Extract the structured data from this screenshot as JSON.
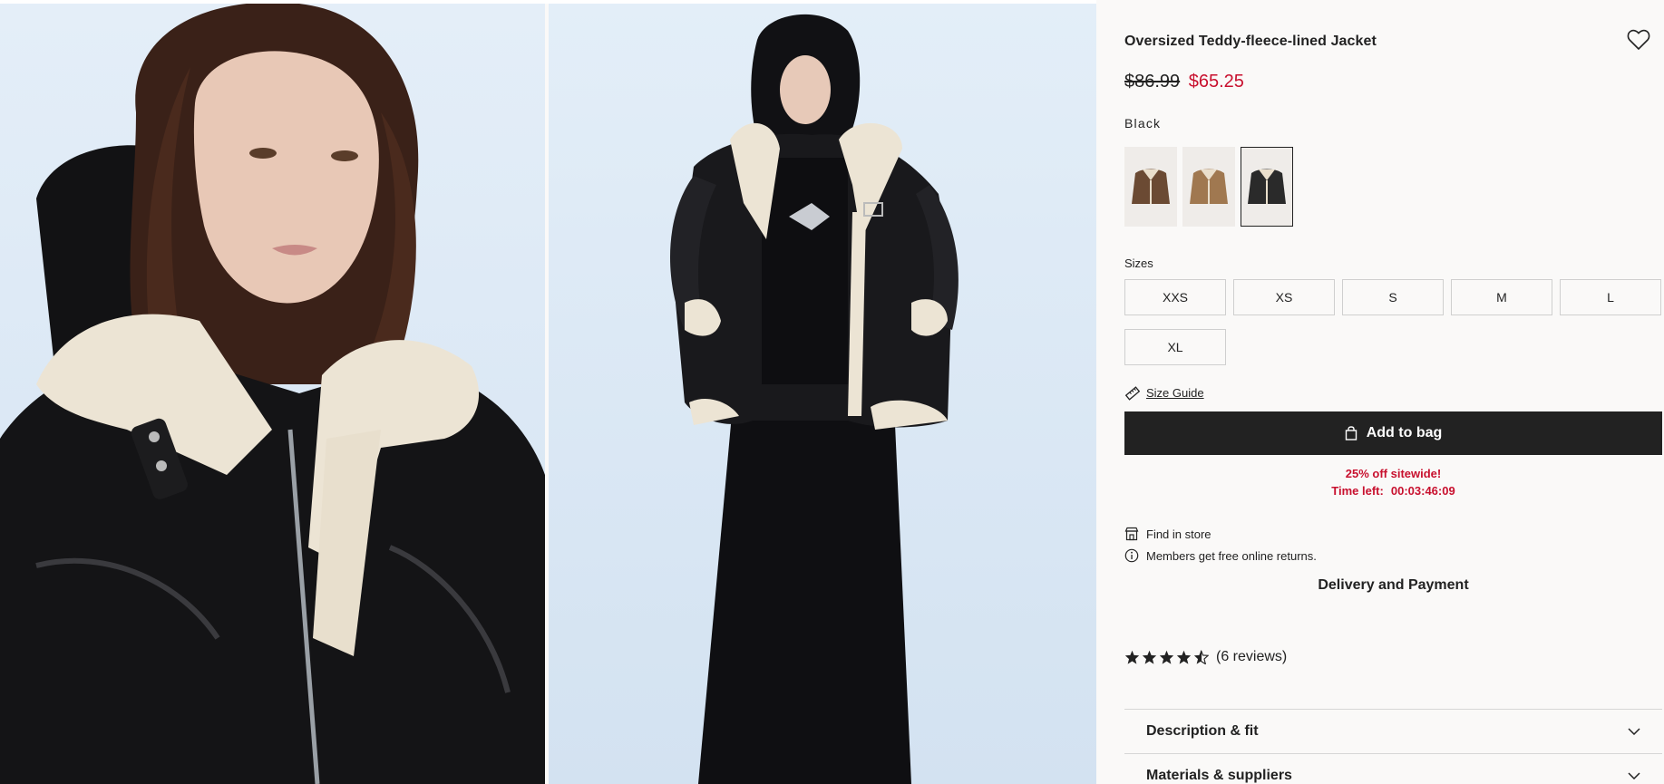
{
  "product": {
    "title": "Oversized Teddy-fleece-lined Jacket",
    "old_price": "$86.99",
    "new_price": "$65.25",
    "color_label": "Black",
    "swatches": [
      {
        "name": "brown",
        "color": "#6b4a33"
      },
      {
        "name": "tan",
        "color": "#a07850"
      },
      {
        "name": "black",
        "color": "#2a2a2a",
        "selected": true
      }
    ],
    "sizes_label": "Sizes",
    "sizes": [
      "XXS",
      "XS",
      "S",
      "M",
      "L",
      "XL"
    ],
    "size_guide": "Size Guide",
    "add_to_bag": "Add to bag",
    "promo": {
      "line1": "25% off sitewide!",
      "time_label": "Time left:",
      "time_value": "00:03:46:09"
    },
    "find_in_store": "Find in store",
    "free_returns": "Members get free online returns.",
    "delivery": "Delivery and Payment",
    "rating": 4.5,
    "reviews": "(6 reviews)",
    "accordions": [
      "Description & fit",
      "Materials & suppliers"
    ]
  },
  "colors": {
    "sale": "#c8102e",
    "button_bg": "#222222",
    "page_bg": "#faf9f8"
  },
  "icons": {
    "favorite": "heart-icon",
    "size_guide": "ruler-icon",
    "bag": "shopping-bag-icon",
    "store": "store-icon",
    "info": "info-icon",
    "star": "star-icon",
    "chevron": "chevron-down-icon"
  }
}
